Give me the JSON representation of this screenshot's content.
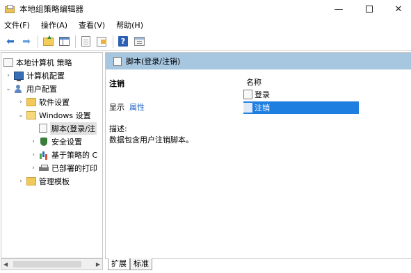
{
  "window": {
    "title": "本地组策略编辑器"
  },
  "menu": [
    "文件(F)",
    "操作(A)",
    "查看(V)",
    "帮助(H)"
  ],
  "tree": {
    "root": "本地计算机 策略",
    "computer_config": "计算机配置",
    "user_config": "用户配置",
    "software_settings": "软件设置",
    "windows_settings": "Windows 设置",
    "scripts": "脚本(登录/注",
    "security_settings": "安全设置",
    "policy_based": "基于策略的 C",
    "deployed_printers": "已部署的打印",
    "admin_templates": "管理模板"
  },
  "right": {
    "header": "脚本(登录/注销)",
    "ext_title": "注销",
    "show_label": "显示",
    "properties_link": "属性",
    "desc_label": "描述:",
    "desc_text": "数据包含用户注销脚本。",
    "column_name": "名称",
    "items": [
      "登录",
      "注销"
    ],
    "selected_item": "注销"
  },
  "tabs": [
    "扩展",
    "标准"
  ],
  "icons": {
    "back": "back-arrow-icon",
    "forward": "forward-arrow-icon",
    "up": "folder-up-icon",
    "console_tree": "show-hide-tree-icon",
    "export": "export-list-icon",
    "help": "help-icon",
    "properties": "properties-icon"
  },
  "colors": {
    "header_bg": "#a7c6e0",
    "selection": "#1f7fe0",
    "link": "#1a62c4"
  }
}
